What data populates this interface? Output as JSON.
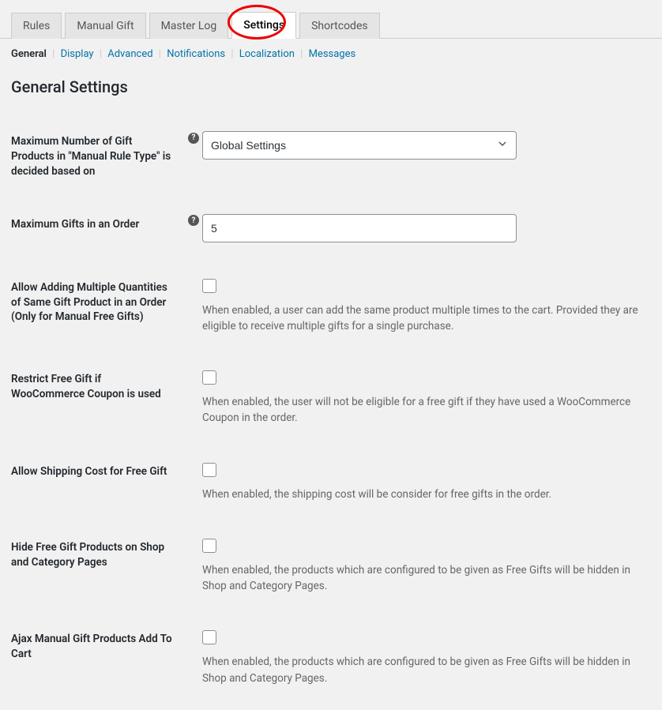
{
  "tabs": {
    "items": [
      {
        "label": "Rules",
        "active": false
      },
      {
        "label": "Manual Gift",
        "active": false
      },
      {
        "label": "Master Log",
        "active": false
      },
      {
        "label": "Settings",
        "active": true
      },
      {
        "label": "Shortcodes",
        "active": false
      }
    ]
  },
  "subnav": {
    "items": [
      {
        "label": "General",
        "current": true
      },
      {
        "label": "Display",
        "current": false
      },
      {
        "label": "Advanced",
        "current": false
      },
      {
        "label": "Notifications",
        "current": false
      },
      {
        "label": "Localization",
        "current": false
      },
      {
        "label": "Messages",
        "current": false
      }
    ]
  },
  "heading": "General Settings",
  "fields": {
    "max_products": {
      "label": "Maximum Number of Gift Products in \"Manual Rule Type\" is decided based on",
      "value": "Global Settings"
    },
    "max_gifts": {
      "label": "Maximum Gifts in an Order",
      "value": "5"
    },
    "allow_multi_qty": {
      "label": "Allow Adding Multiple Quantities of Same Gift Product in an Order (Only for Manual Free Gifts)",
      "desc": "When enabled, a user can add the same product multiple times to the cart. Provided they are eligible to receive multiple gifts for a single purchase."
    },
    "restrict_coupon": {
      "label": "Restrict Free Gift if WooCommerce Coupon is used",
      "desc": "When enabled, the user will not be eligible for a free gift if they have used a WooCommerce Coupon in the order."
    },
    "allow_shipping": {
      "label": "Allow Shipping Cost for Free Gift",
      "desc": "When enabled, the shipping cost will be consider for free gifts in the order."
    },
    "hide_products": {
      "label": "Hide Free Gift Products on Shop and Category Pages",
      "desc": "When enabled, the products which are configured to be given as Free Gifts will be hidden in Shop and Category Pages."
    },
    "ajax_add": {
      "label": "Ajax Manual Gift Products Add To Cart",
      "desc": "When enabled, the products which are configured to be given as Free Gifts will be hidden in Shop and Category Pages."
    }
  }
}
